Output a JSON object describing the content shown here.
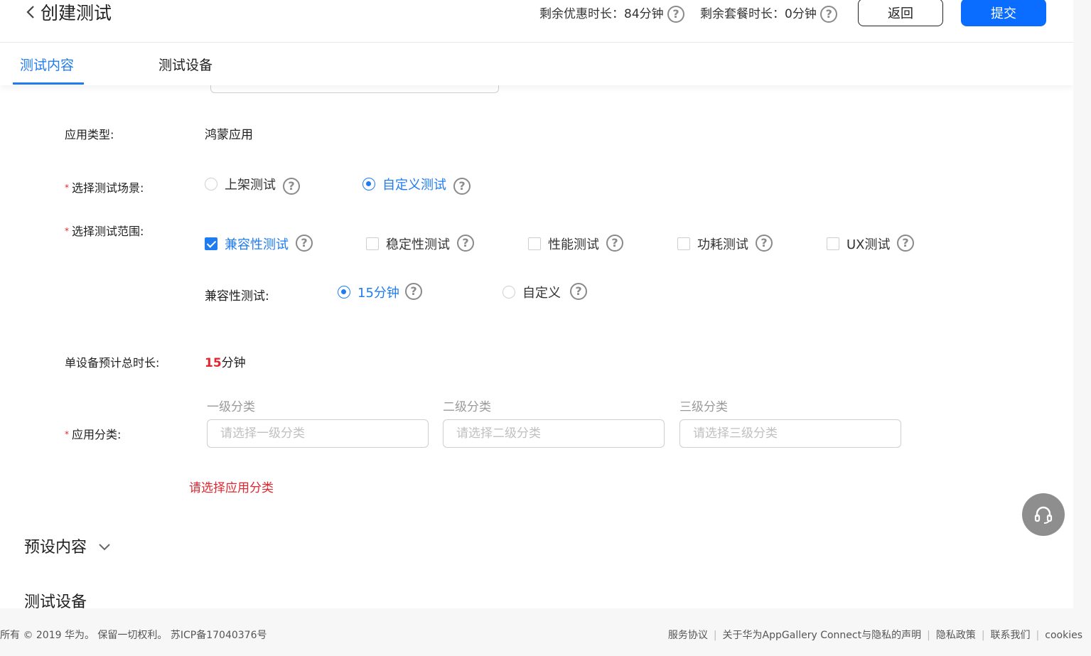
{
  "header": {
    "title": "创建测试",
    "discount_quota": "剩余优惠时长：84分钟",
    "package_quota": "剩余套餐时长：0分钟",
    "back_label": "返回",
    "submit_label": "提交",
    "help_glyph": "?"
  },
  "tabs": [
    {
      "label": "测试内容",
      "active": true
    },
    {
      "label": "测试设备",
      "active": false
    }
  ],
  "form": {
    "app_type": {
      "label": "应用类型:",
      "value": "鸿蒙应用"
    },
    "scenario": {
      "label": "选择测试场景:",
      "options": [
        {
          "label": "上架测试",
          "checked": false
        },
        {
          "label": "自定义测试",
          "checked": true
        }
      ]
    },
    "scope": {
      "label": "选择测试范围:",
      "options": [
        {
          "label": "兼容性测试",
          "checked": true
        },
        {
          "label": "稳定性测试",
          "checked": false
        },
        {
          "label": "性能测试",
          "checked": false
        },
        {
          "label": "功耗测试",
          "checked": false
        },
        {
          "label": "UX测试",
          "checked": false
        }
      ]
    },
    "compat": {
      "label": "兼容性测试:",
      "options": [
        {
          "label": "15分钟",
          "checked": true
        },
        {
          "label": "自定义",
          "checked": false
        }
      ]
    },
    "duration": {
      "label": "单设备预计总时长:",
      "value": "15",
      "unit": "分钟"
    },
    "category": {
      "label": "应用分类:",
      "levels": [
        {
          "header": "一级分类",
          "placeholder": "请选择一级分类",
          "value": ""
        },
        {
          "header": "二级分类",
          "placeholder": "请选择二级分类",
          "value": ""
        },
        {
          "header": "三级分类",
          "placeholder": "请选择三级分类",
          "value": ""
        }
      ],
      "error": "请选择应用分类"
    },
    "required_mark": "*"
  },
  "sections": {
    "preset": "预设内容",
    "devices": "测试设备"
  },
  "footer": {
    "copyright": "所有 © 2019 华为。 保留一切权利。 苏ICP备17040376号",
    "links": [
      "服务协议",
      "关于华为AppGallery Connect与隐私的声明",
      "隐私政策",
      "联系我们",
      "cookies"
    ],
    "separator": "|"
  },
  "colors": {
    "accent": "#1f7cf0",
    "submit": "#0a6dff",
    "error": "#e0262e"
  }
}
